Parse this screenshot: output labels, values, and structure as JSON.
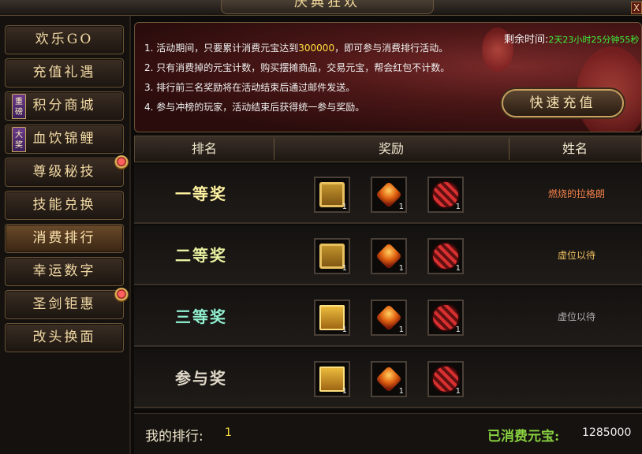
{
  "window": {
    "title": "庆典狂欢",
    "close_label": "X"
  },
  "sidebar": {
    "items": [
      {
        "label": "欢乐GO"
      },
      {
        "label": "充值礼遇"
      },
      {
        "label": "积分商城",
        "tag": "重磅"
      },
      {
        "label": "血饮锦鲤",
        "tag": "大奖"
      },
      {
        "label": "尊级秘技",
        "badge": true
      },
      {
        "label": "技能兑换"
      },
      {
        "label": "消费排行",
        "active": true
      },
      {
        "label": "幸运数字"
      },
      {
        "label": "圣剑钜惠",
        "badge": true
      },
      {
        "label": "改头换面"
      }
    ]
  },
  "banner": {
    "rules": [
      {
        "prefix": "1. 活动期间，只要累计消费元宝达到",
        "highlight": "300000",
        "suffix": "，即可参与消费排行活动。"
      },
      {
        "prefix": "2. 只有消费掉的元宝计数，购买摆摊商品，交易元宝，帮会红包不计数。",
        "highlight": "",
        "suffix": ""
      },
      {
        "prefix": "3. 排行前三名奖励将在活动结束后通过邮件发送。",
        "highlight": "",
        "suffix": ""
      },
      {
        "prefix": "4. 参与冲榜的玩家，活动结束后获得统一参与奖励。",
        "highlight": "",
        "suffix": ""
      }
    ],
    "time_label": "剩余时间:",
    "time_value": "2天23小时25分钟55秒",
    "quick_recharge": "快速充值"
  },
  "table": {
    "headers": {
      "rank": "排名",
      "reward": "奖励",
      "name": "姓名"
    },
    "rows": [
      {
        "prize": "一等奖",
        "prize_color": "#fff2a0",
        "name": "燃烧的拉格朗",
        "name_color": "#f0804a",
        "items": [
          {
            "icon": "treasure-chest-icon",
            "qty": "1"
          },
          {
            "icon": "orange-gem-icon",
            "qty": "1"
          },
          {
            "icon": "red-orb-icon",
            "qty": "1"
          }
        ]
      },
      {
        "prize": "二等奖",
        "prize_color": "#e8f0a0",
        "name": "虚位以待",
        "name_color": "#f0c060",
        "items": [
          {
            "icon": "treasure-chest-icon",
            "qty": "1"
          },
          {
            "icon": "orange-gem-icon",
            "qty": "1"
          },
          {
            "icon": "red-orb-icon",
            "qty": "1"
          }
        ]
      },
      {
        "prize": "三等奖",
        "prize_color": "#90f0d0",
        "name": "虚位以待",
        "name_color": "#b0b0b0",
        "items": [
          {
            "icon": "golden-chest-icon",
            "qty": "1"
          },
          {
            "icon": "orange-gem-icon",
            "qty": "1"
          },
          {
            "icon": "red-orb-icon",
            "qty": "1"
          }
        ]
      },
      {
        "prize": "参与奖",
        "prize_color": "#e0d8c8",
        "name": "",
        "name_color": "#b0b0b0",
        "items": [
          {
            "icon": "golden-chest-icon",
            "qty": "1"
          },
          {
            "icon": "orange-gem-icon",
            "qty": "1"
          },
          {
            "icon": "red-orb-icon",
            "qty": "1"
          }
        ]
      }
    ]
  },
  "footer": {
    "my_rank_label": "我的排行:",
    "my_rank_value": "1",
    "spent_label": "已消费元宝:",
    "spent_value": "1285000"
  },
  "colors": {
    "accent_gold": "#f2d9a4",
    "highlight": "#ffe040",
    "time_green": "#3cf03c",
    "spent_green": "#88d040"
  }
}
